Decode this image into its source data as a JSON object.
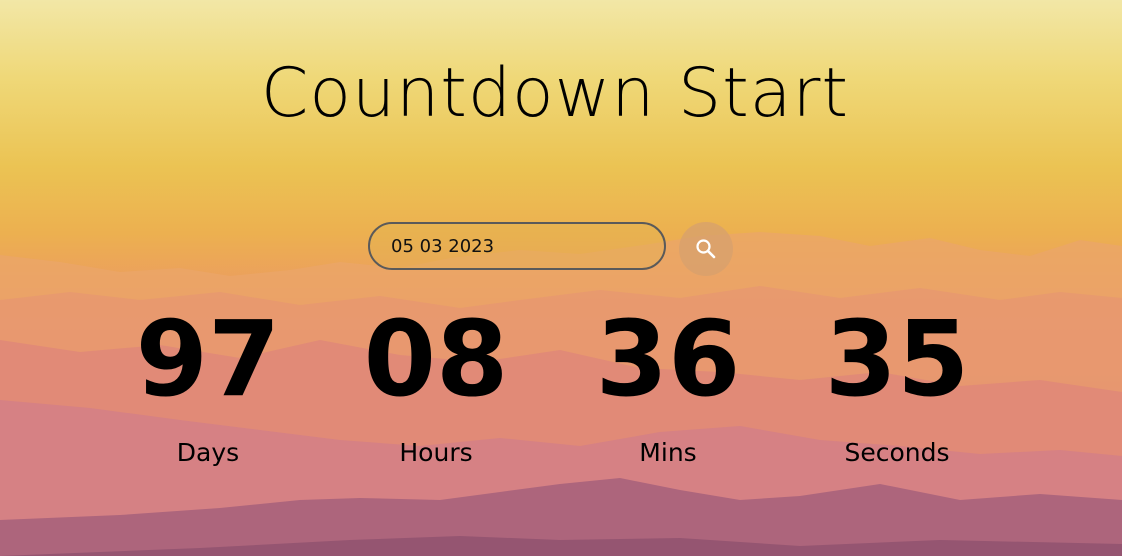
{
  "title": "Countdown Start",
  "date_input": {
    "value": "05 03 2023"
  },
  "search_button": {
    "icon": "search-icon"
  },
  "countdown": [
    {
      "value": "97",
      "label": "Days"
    },
    {
      "value": "08",
      "label": "Hours"
    },
    {
      "value": "36",
      "label": "Mins"
    },
    {
      "value": "35",
      "label": "Seconds"
    }
  ],
  "colors": {
    "sky_top": "#f2e7a6",
    "sky_mid": "#ebc353",
    "mountain_orange": "#eb9d5f",
    "mountain_pink": "#cf7c8c",
    "text": "#000000"
  }
}
